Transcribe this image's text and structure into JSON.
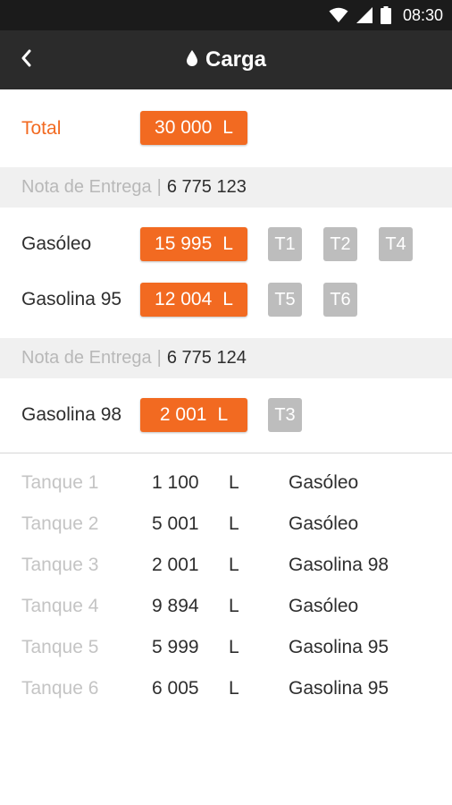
{
  "status_bar": {
    "time": "08:30"
  },
  "app_bar": {
    "title": "Carga",
    "icons": [
      "back-arrow-icon",
      "drop-icon"
    ]
  },
  "total": {
    "label": "Total",
    "amount": "30 000",
    "unit": "L"
  },
  "deliveries": [
    {
      "note_label": "Nota de Entrega",
      "separator": "|",
      "note_number": "6 775 123",
      "items": [
        {
          "fuel": "Gasóleo",
          "amount": "15 995",
          "unit": "L",
          "tanks": [
            "T1",
            "T2",
            "T4"
          ]
        },
        {
          "fuel": "Gasolina 95",
          "amount": "12 004",
          "unit": "L",
          "tanks": [
            "T5",
            "T6"
          ]
        }
      ]
    },
    {
      "note_label": "Nota de Entrega",
      "separator": "|",
      "note_number": "6 775 124",
      "items": [
        {
          "fuel": "Gasolina 98",
          "amount": "2 001",
          "unit": "L",
          "tanks": [
            "T3"
          ]
        }
      ]
    }
  ],
  "tanks": [
    {
      "name": "Tanque 1",
      "qty": "1 100",
      "unit": "L",
      "fuel": "Gasóleo"
    },
    {
      "name": "Tanque 2",
      "qty": "5 001",
      "unit": "L",
      "fuel": "Gasóleo"
    },
    {
      "name": "Tanque 3",
      "qty": "2 001",
      "unit": "L",
      "fuel": "Gasolina 98"
    },
    {
      "name": "Tanque 4",
      "qty": "9 894",
      "unit": "L",
      "fuel": "Gasóleo"
    },
    {
      "name": "Tanque 5",
      "qty": "5 999",
      "unit": "L",
      "fuel": "Gasolina 95"
    },
    {
      "name": "Tanque 6",
      "qty": "6 005",
      "unit": "L",
      "fuel": "Gasolina 95"
    }
  ],
  "colors": {
    "accent": "#f26a21",
    "tank_button": "#bdbdbd",
    "app_bar": "#2b2b2b",
    "status_bar": "#1b1b1b",
    "note_bar": "#f0f0f0"
  }
}
